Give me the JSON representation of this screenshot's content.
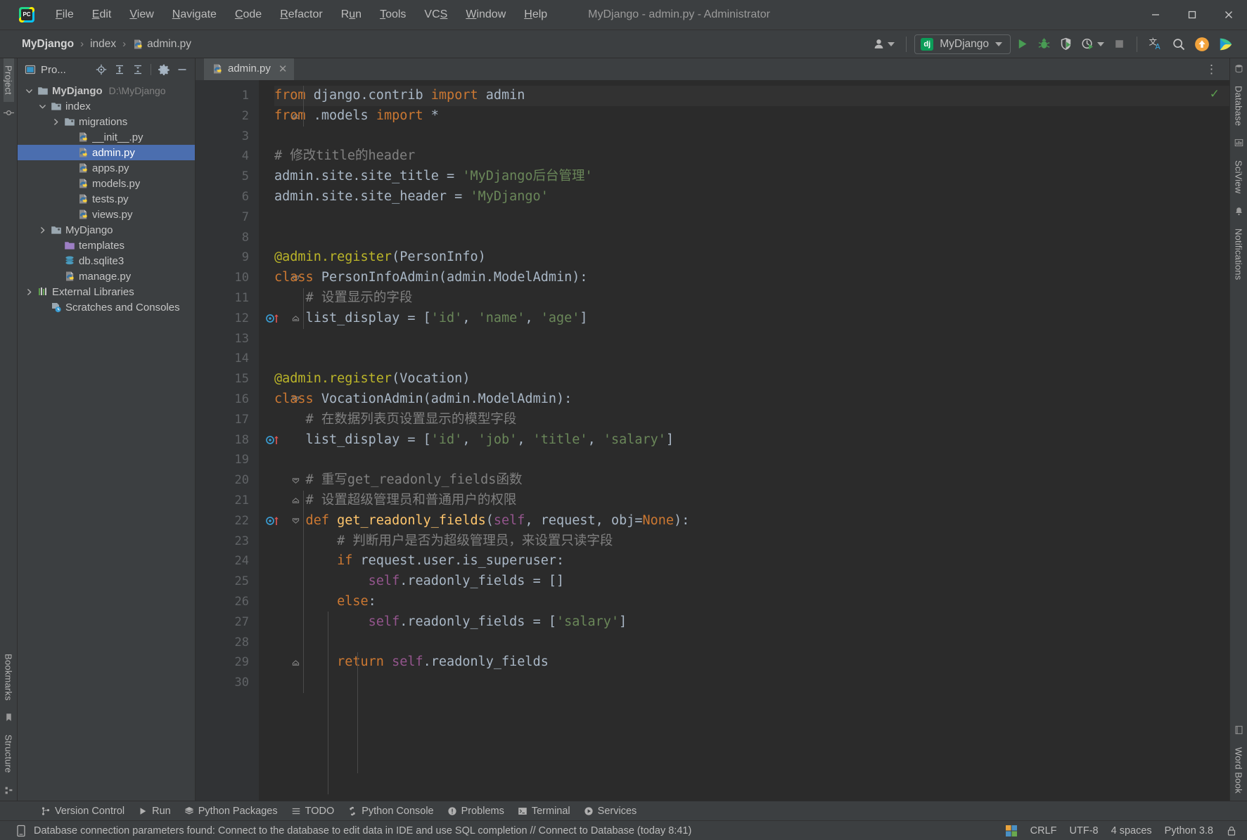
{
  "window": {
    "title": "MyDjango - admin.py - Administrator",
    "minimize": "–",
    "maximize": "□",
    "close": "✕"
  },
  "menu": [
    {
      "label": "File",
      "mnemonic": "F"
    },
    {
      "label": "Edit",
      "mnemonic": "E"
    },
    {
      "label": "View",
      "mnemonic": "V"
    },
    {
      "label": "Navigate",
      "mnemonic": "N"
    },
    {
      "label": "Code",
      "mnemonic": "C"
    },
    {
      "label": "Refactor",
      "mnemonic": "R"
    },
    {
      "label": "Run",
      "mnemonic": "u"
    },
    {
      "label": "Tools",
      "mnemonic": "T"
    },
    {
      "label": "VCS",
      "mnemonic": "S"
    },
    {
      "label": "Window",
      "mnemonic": "W"
    },
    {
      "label": "Help",
      "mnemonic": "H"
    }
  ],
  "breadcrumb": {
    "project": "MyDjango",
    "sep1": "›",
    "folder": "index",
    "sep2": "›",
    "file": "admin.py"
  },
  "toolbar": {
    "run_config": "MyDjango",
    "run_config_badge": "dj",
    "run_label": "Run",
    "debug_label": "Debug",
    "coverage_label": "Run with Coverage",
    "profile_label": "Profile",
    "stop_label": "Stop",
    "translate_label": "Translate",
    "search_label": "Search Everywhere",
    "update_label": "Update",
    "feedback_label": "Feedback"
  },
  "project_panel": {
    "title": "Pro...",
    "locate_label": "Select Opened File",
    "expand_label": "Expand All",
    "collapse_label": "Collapse All",
    "settings_label": "Options",
    "hide_label": "Hide",
    "tree": [
      {
        "label": "MyDjango",
        "path": "D:\\MyDjango",
        "indent": 0,
        "arrow": "down",
        "icon": "folder-module",
        "bold": true,
        "selected": false
      },
      {
        "label": "index",
        "path": "",
        "indent": 1,
        "arrow": "down",
        "icon": "folder-source",
        "bold": false,
        "selected": false
      },
      {
        "label": "migrations",
        "path": "",
        "indent": 2,
        "arrow": "right",
        "icon": "folder-source",
        "bold": false,
        "selected": false
      },
      {
        "label": "__init__.py",
        "path": "",
        "indent": 3,
        "arrow": "none",
        "icon": "python-file",
        "bold": false,
        "selected": false
      },
      {
        "label": "admin.py",
        "path": "",
        "indent": 3,
        "arrow": "none",
        "icon": "python-file",
        "bold": false,
        "selected": true
      },
      {
        "label": "apps.py",
        "path": "",
        "indent": 3,
        "arrow": "none",
        "icon": "python-file",
        "bold": false,
        "selected": false
      },
      {
        "label": "models.py",
        "path": "",
        "indent": 3,
        "arrow": "none",
        "icon": "python-file",
        "bold": false,
        "selected": false
      },
      {
        "label": "tests.py",
        "path": "",
        "indent": 3,
        "arrow": "none",
        "icon": "python-file",
        "bold": false,
        "selected": false
      },
      {
        "label": "views.py",
        "path": "",
        "indent": 3,
        "arrow": "none",
        "icon": "python-file",
        "bold": false,
        "selected": false
      },
      {
        "label": "MyDjango",
        "path": "",
        "indent": 1,
        "arrow": "right",
        "icon": "folder-source",
        "bold": false,
        "selected": false
      },
      {
        "label": "templates",
        "path": "",
        "indent": 2,
        "arrow": "none",
        "icon": "folder-templates",
        "bold": false,
        "selected": false
      },
      {
        "label": "db.sqlite3",
        "path": "",
        "indent": 2,
        "arrow": "none",
        "icon": "database-file",
        "bold": false,
        "selected": false
      },
      {
        "label": "manage.py",
        "path": "",
        "indent": 2,
        "arrow": "none",
        "icon": "python-file",
        "bold": false,
        "selected": false
      },
      {
        "label": "External Libraries",
        "path": "",
        "indent": 0,
        "arrow": "right",
        "icon": "library",
        "bold": false,
        "selected": false
      },
      {
        "label": "Scratches and Consoles",
        "path": "",
        "indent": 1,
        "arrow": "none",
        "icon": "scratches",
        "bold": false,
        "selected": false
      }
    ]
  },
  "left_strip": {
    "project_tab": "Project",
    "bookmarks_tab": "Bookmarks",
    "structure_tab": "Structure"
  },
  "right_strip": {
    "database_tab": "Database",
    "scivew_tab": "SciView",
    "notifications_tab": "Notifications",
    "wordbook_tab": "Word Book"
  },
  "editor": {
    "tab_label": "admin.py",
    "tab_close": "✕",
    "more_options": "⋮",
    "inspection_status": "✓",
    "lines": [
      {
        "n": 1,
        "fold": "start-dash",
        "mark": "",
        "tokens": [
          {
            "t": "from",
            "c": "kw"
          },
          {
            "t": " django.contrib ",
            "c": "plain"
          },
          {
            "t": "import",
            "c": "kw"
          },
          {
            "t": " admin",
            "c": "plain"
          }
        ]
      },
      {
        "n": 2,
        "fold": "end",
        "mark": "",
        "tokens": [
          {
            "t": "from",
            "c": "kw"
          },
          {
            "t": " .models ",
            "c": "plain"
          },
          {
            "t": "import",
            "c": "kw"
          },
          {
            "t": " *",
            "c": "plain"
          }
        ]
      },
      {
        "n": 3,
        "fold": "",
        "mark": "",
        "tokens": []
      },
      {
        "n": 4,
        "fold": "",
        "mark": "",
        "tokens": [
          {
            "t": "# 修改title的header",
            "c": "com"
          }
        ]
      },
      {
        "n": 5,
        "fold": "",
        "mark": "",
        "tokens": [
          {
            "t": "admin.site.site_title = ",
            "c": "plain"
          },
          {
            "t": "'MyDjango后台管理'",
            "c": "str"
          }
        ]
      },
      {
        "n": 6,
        "fold": "",
        "mark": "",
        "tokens": [
          {
            "t": "admin.site.site_header = ",
            "c": "plain"
          },
          {
            "t": "'MyDjango'",
            "c": "str"
          }
        ]
      },
      {
        "n": 7,
        "fold": "",
        "mark": "",
        "tokens": []
      },
      {
        "n": 8,
        "fold": "",
        "mark": "",
        "tokens": []
      },
      {
        "n": 9,
        "fold": "",
        "mark": "",
        "tokens": [
          {
            "t": "@admin.register",
            "c": "dec"
          },
          {
            "t": "(PersonInfo)",
            "c": "plain"
          }
        ]
      },
      {
        "n": 10,
        "fold": "start",
        "mark": "",
        "tokens": [
          {
            "t": "class",
            "c": "kw"
          },
          {
            "t": " PersonInfoAdmin(admin.ModelAdmin):",
            "c": "plain"
          }
        ]
      },
      {
        "n": 11,
        "fold": "",
        "mark": "",
        "tokens": [
          {
            "t": "    # 设置显示的字段",
            "c": "com"
          }
        ]
      },
      {
        "n": 12,
        "fold": "end",
        "mark": "override",
        "tokens": [
          {
            "t": "    list_display = [",
            "c": "plain"
          },
          {
            "t": "'id'",
            "c": "str"
          },
          {
            "t": ", ",
            "c": "plain"
          },
          {
            "t": "'name'",
            "c": "str"
          },
          {
            "t": ", ",
            "c": "plain"
          },
          {
            "t": "'age'",
            "c": "str"
          },
          {
            "t": "]",
            "c": "plain"
          }
        ]
      },
      {
        "n": 13,
        "fold": "",
        "mark": "",
        "tokens": []
      },
      {
        "n": 14,
        "fold": "",
        "mark": "",
        "tokens": []
      },
      {
        "n": 15,
        "fold": "",
        "mark": "",
        "tokens": [
          {
            "t": "@admin.register",
            "c": "dec"
          },
          {
            "t": "(Vocation)",
            "c": "plain"
          }
        ]
      },
      {
        "n": 16,
        "fold": "start",
        "mark": "",
        "tokens": [
          {
            "t": "class",
            "c": "kw"
          },
          {
            "t": " VocationAdmin(admin.ModelAdmin):",
            "c": "plain"
          }
        ]
      },
      {
        "n": 17,
        "fold": "",
        "mark": "",
        "tokens": [
          {
            "t": "    # 在数据列表页设置显示的模型字段",
            "c": "com"
          }
        ]
      },
      {
        "n": 18,
        "fold": "",
        "mark": "override",
        "tokens": [
          {
            "t": "    list_display = [",
            "c": "plain"
          },
          {
            "t": "'id'",
            "c": "str"
          },
          {
            "t": ", ",
            "c": "plain"
          },
          {
            "t": "'job'",
            "c": "str"
          },
          {
            "t": ", ",
            "c": "plain"
          },
          {
            "t": "'title'",
            "c": "str"
          },
          {
            "t": ", ",
            "c": "plain"
          },
          {
            "t": "'salary'",
            "c": "str"
          },
          {
            "t": "]",
            "c": "plain"
          }
        ]
      },
      {
        "n": 19,
        "fold": "",
        "mark": "",
        "tokens": []
      },
      {
        "n": 20,
        "fold": "start-dash",
        "mark": "",
        "tokens": [
          {
            "t": "    # 重写get_readonly_fields函数",
            "c": "com"
          }
        ]
      },
      {
        "n": 21,
        "fold": "end",
        "mark": "",
        "tokens": [
          {
            "t": "    # 设置超级管理员和普通用户的权限",
            "c": "com"
          }
        ]
      },
      {
        "n": 22,
        "fold": "start-dash",
        "mark": "override",
        "tokens": [
          {
            "t": "    def",
            "c": "kw"
          },
          {
            "t": " ",
            "c": "plain"
          },
          {
            "t": "get_readonly_fields",
            "c": "fn"
          },
          {
            "t": "(",
            "c": "plain"
          },
          {
            "t": "self",
            "c": "self"
          },
          {
            "t": ", request, obj=",
            "c": "plain"
          },
          {
            "t": "None",
            "c": "kw"
          },
          {
            "t": "):",
            "c": "plain"
          }
        ]
      },
      {
        "n": 23,
        "fold": "",
        "mark": "",
        "tokens": [
          {
            "t": "        # 判断用户是否为超级管理员，来设置只读字段",
            "c": "com"
          }
        ]
      },
      {
        "n": 24,
        "fold": "",
        "mark": "",
        "tokens": [
          {
            "t": "        ",
            "c": "plain"
          },
          {
            "t": "if",
            "c": "kw"
          },
          {
            "t": " request.user.is_superuser:",
            "c": "plain"
          }
        ]
      },
      {
        "n": 25,
        "fold": "",
        "mark": "",
        "tokens": [
          {
            "t": "            ",
            "c": "plain"
          },
          {
            "t": "self",
            "c": "self"
          },
          {
            "t": ".readonly_fields = []",
            "c": "plain"
          }
        ]
      },
      {
        "n": 26,
        "fold": "",
        "mark": "",
        "tokens": [
          {
            "t": "        ",
            "c": "plain"
          },
          {
            "t": "else",
            "c": "kw"
          },
          {
            "t": ":",
            "c": "plain"
          }
        ]
      },
      {
        "n": 27,
        "fold": "",
        "mark": "",
        "tokens": [
          {
            "t": "            ",
            "c": "plain"
          },
          {
            "t": "self",
            "c": "self"
          },
          {
            "t": ".readonly_fields = [",
            "c": "plain"
          },
          {
            "t": "'salary'",
            "c": "str"
          },
          {
            "t": "]",
            "c": "plain"
          }
        ]
      },
      {
        "n": 28,
        "fold": "",
        "mark": "",
        "tokens": []
      },
      {
        "n": 29,
        "fold": "end",
        "mark": "",
        "tokens": [
          {
            "t": "        ",
            "c": "plain"
          },
          {
            "t": "return",
            "c": "kw"
          },
          {
            "t": " ",
            "c": "plain"
          },
          {
            "t": "self",
            "c": "self"
          },
          {
            "t": ".readonly_fields",
            "c": "plain"
          }
        ]
      },
      {
        "n": 30,
        "fold": "",
        "mark": "",
        "tokens": []
      }
    ]
  },
  "toolwindows": [
    {
      "label": "Version Control",
      "icon": "branch-icon"
    },
    {
      "label": "Run",
      "icon": "run-icon"
    },
    {
      "label": "Python Packages",
      "icon": "packages-icon"
    },
    {
      "label": "TODO",
      "icon": "todo-icon"
    },
    {
      "label": "Python Console",
      "icon": "python-icon"
    },
    {
      "label": "Problems",
      "icon": "problems-icon"
    },
    {
      "label": "Terminal",
      "icon": "terminal-icon"
    },
    {
      "label": "Services",
      "icon": "services-icon"
    }
  ],
  "statusbar": {
    "message": "Database connection parameters found: Connect to the database to edit data in IDE and use SQL completion // Connect to Database (today 8:41)",
    "line_sep": "CRLF",
    "encoding": "UTF-8",
    "indent": "4 spaces",
    "interpreter": "Python 3.8"
  },
  "colors": {
    "bg_chrome": "#3c3f41",
    "bg_editor": "#2b2b2b",
    "bg_gutter": "#313335",
    "accent_selection": "#4b6eaf",
    "keyword": "#cc7832",
    "string": "#6a8759",
    "comment": "#808080",
    "decorator": "#bbb529",
    "function": "#ffc66d",
    "self": "#94558d",
    "default_text": "#a9b7c6"
  }
}
